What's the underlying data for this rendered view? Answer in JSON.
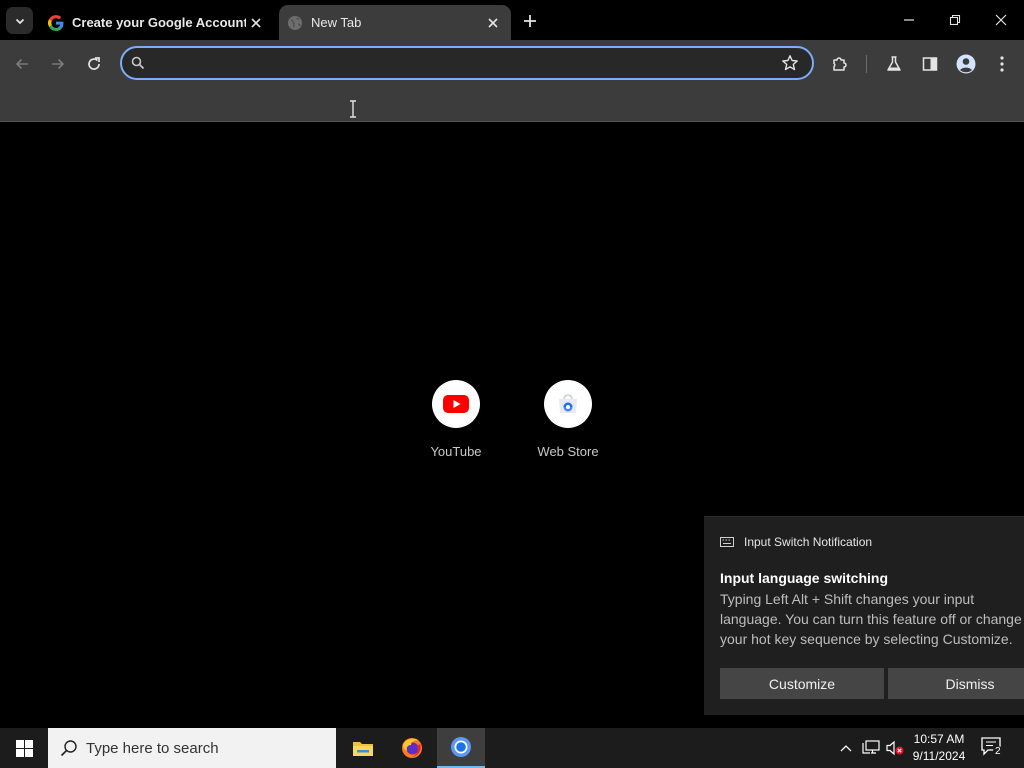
{
  "browser": {
    "tabs": [
      {
        "title": "Create your Google Account",
        "icon": "google-g-icon",
        "active": false
      },
      {
        "title": "New Tab",
        "icon": "globe-icon",
        "active": true
      }
    ],
    "omnibox": {
      "value": "",
      "placeholder": ""
    },
    "colors": {
      "toolbar": "#3c3c3c",
      "omnibox_focus": "#7cacf8",
      "ntp_background": "#000000"
    }
  },
  "ntp": {
    "shortcuts": [
      {
        "label": "YouTube",
        "icon": "youtube-icon"
      },
      {
        "label": "Web Store",
        "icon": "chrome-web-store-icon"
      }
    ]
  },
  "notification": {
    "app_name": "Input Switch Notification",
    "title": "Input language switching",
    "body_lines": [
      "Typing Left Alt + Shift changes your input",
      "language. You can turn this feature off or change",
      "your hot key sequence by selecting Customize."
    ],
    "buttons": {
      "customize": "Customize",
      "dismiss": "Dismiss"
    }
  },
  "taskbar": {
    "search_placeholder": "Type here to search",
    "apps": [
      {
        "name": "File Explorer",
        "icon": "file-explorer-icon"
      },
      {
        "name": "Firefox",
        "icon": "firefox-icon"
      },
      {
        "name": "Chrome",
        "icon": "chrome-icon",
        "active": true
      }
    ],
    "clock": {
      "time": "10:57 AM",
      "date": "9/11/2024"
    },
    "notifications_count": "2"
  }
}
